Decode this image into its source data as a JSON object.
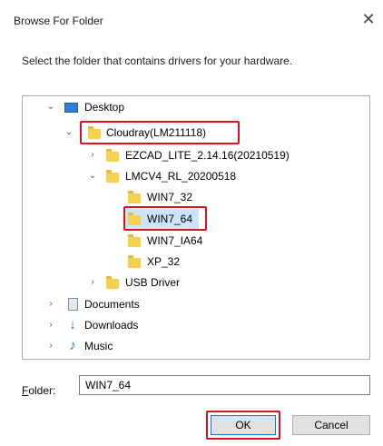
{
  "window": {
    "title": "Browse For Folder"
  },
  "instruction": "Select the folder that contains drivers for your hardware.",
  "tree": {
    "desktop": "Desktop",
    "cloudray": "Cloudray(LM211118)",
    "ezcad": "EZCAD_LITE_2.14.16(20210519)",
    "lmcv4": "LMCV4_RL_20200518",
    "win7_32": "WIN7_32",
    "win7_64": "WIN7_64",
    "win7_ia64": "WIN7_IA64",
    "xp_32": "XP_32",
    "usb_driver": "USB Driver",
    "documents": "Documents",
    "downloads": "Downloads",
    "music": "Music"
  },
  "folder_field": {
    "label_first": "F",
    "label_rest": "older:",
    "value": "WIN7_64"
  },
  "buttons": {
    "ok": "OK",
    "cancel": "Cancel"
  },
  "icons": {
    "close": "close-icon",
    "chevron_down": "chevron-down-icon",
    "chevron_right": "chevron-right-icon",
    "folder": "folder-icon",
    "desktop": "desktop-icon",
    "documents": "documents-icon",
    "downloads": "download-arrow-icon",
    "music": "music-note-icon"
  },
  "colors": {
    "highlight": "#d8131b",
    "selection": "#cce4f7",
    "folder": "#f5d04e",
    "accent": "#0078d7"
  }
}
